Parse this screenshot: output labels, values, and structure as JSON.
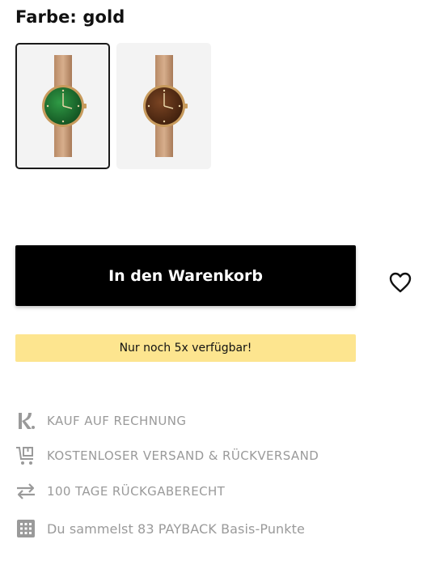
{
  "color": {
    "label": "Farbe: gold",
    "options": [
      {
        "name": "green-dial-watch",
        "dial_color": "#1f6b2f",
        "selected": true
      },
      {
        "name": "brown-dial-watch",
        "dial_color": "#5a2e14",
        "selected": false
      }
    ]
  },
  "actions": {
    "add_to_cart_label": "In den Warenkorb"
  },
  "stock": {
    "text": "Nur noch 5x verfügbar!",
    "badge_color": "#fde58f"
  },
  "benefits": [
    {
      "icon": "klarna-icon",
      "text": "KAUF AUF RECHNUNG"
    },
    {
      "icon": "shipping-cart-icon",
      "text": "KOSTENLOSER VERSAND & RÜCKVERSAND"
    },
    {
      "icon": "return-arrows-icon",
      "text": "100 TAGE RÜCKGABERECHT"
    },
    {
      "icon": "payback-icon",
      "text": "Du sammelst 83 PAYBACK Basis-Punkte"
    }
  ]
}
